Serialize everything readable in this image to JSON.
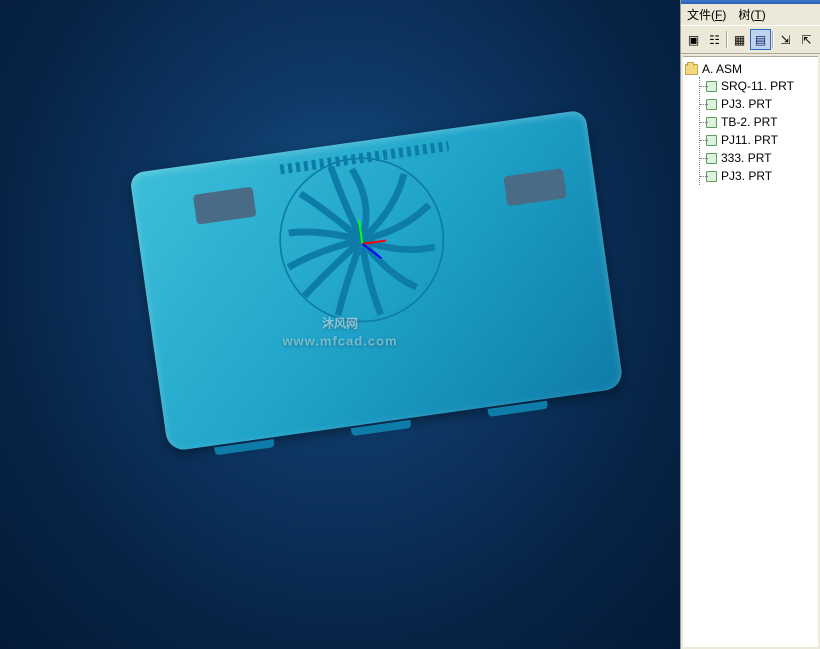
{
  "menu": {
    "file_label": "文件",
    "file_accel": "F",
    "tree_label": "树",
    "tree_accel": "T"
  },
  "toolbar": {
    "btn1": "save-icon",
    "btn2": "layers-icon",
    "btn3": "grid-icon",
    "btn4": "select-icon",
    "btn5": "expand-icon",
    "btn6": "collapse-icon"
  },
  "tree": {
    "root_label": "A. ASM",
    "items": [
      {
        "label": "SRQ-11. PRT"
      },
      {
        "label": "PJ3. PRT"
      },
      {
        "label": "TB-2. PRT"
      },
      {
        "label": "PJ11. PRT"
      },
      {
        "label": "333. PRT"
      },
      {
        "label": "PJ3. PRT"
      }
    ]
  },
  "watermark": {
    "main": "沐风网",
    "sub": "www.mfcad.com"
  }
}
